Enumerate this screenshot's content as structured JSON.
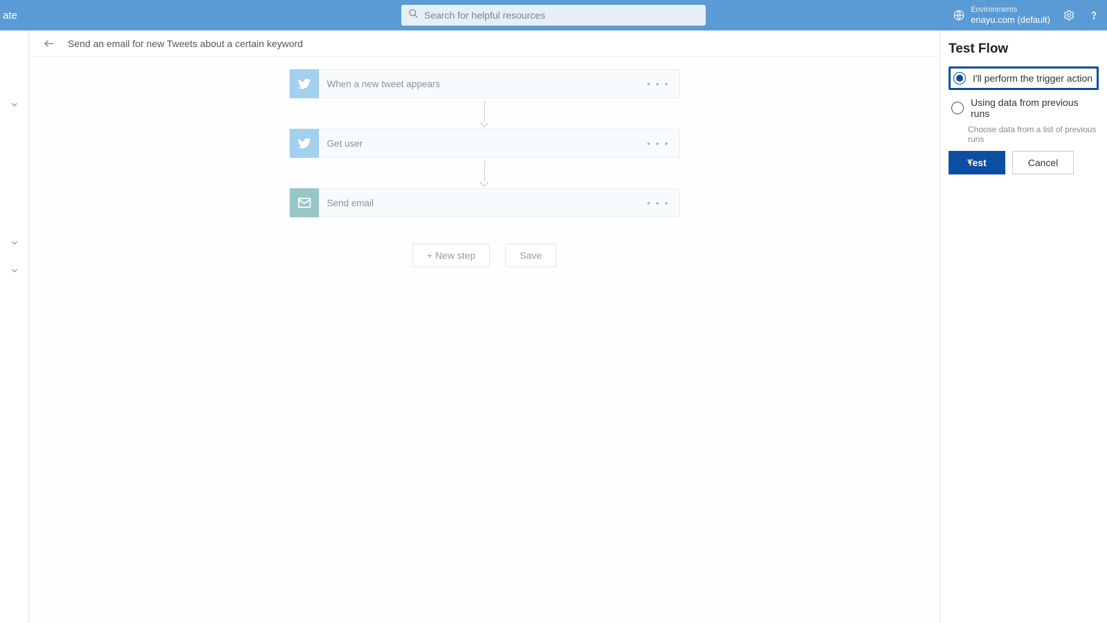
{
  "topbar": {
    "left_label": "ate",
    "search_placeholder": "Search for helpful resources",
    "env_label": "Environments",
    "env_value": "enayu.com (default)"
  },
  "subheader": {
    "title": "Send an email for new Tweets about a certain keyword"
  },
  "flow": {
    "steps": [
      {
        "label": "When a new tweet appears",
        "icon": "twitter"
      },
      {
        "label": "Get user",
        "icon": "twitter"
      },
      {
        "label": "Send email",
        "icon": "mail"
      }
    ],
    "new_step": "+ New step",
    "save": "Save"
  },
  "panel": {
    "title": "Test Flow",
    "option1": "I'll perform the trigger action",
    "option2": "Using data from previous runs",
    "option2_help": "Choose data from a list of previous runs",
    "test": "Test",
    "cancel": "Cancel"
  }
}
